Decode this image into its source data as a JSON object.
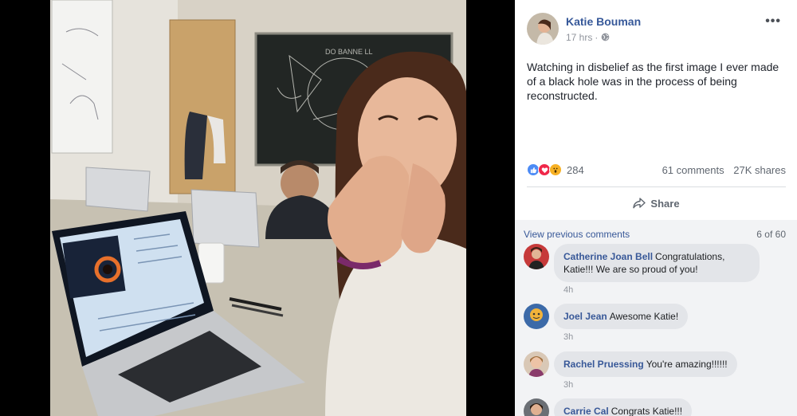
{
  "post": {
    "author": "Katie Bouman",
    "time": "17 hrs",
    "text": "Watching in disbelief as the first image I ever made of a black hole was in the process of being reconstructed.",
    "more_label": "•••"
  },
  "stats": {
    "reactions": "284",
    "comments": "61 comments",
    "shares": "27K shares",
    "reaction_types": [
      "like-icon",
      "love-icon",
      "wow-icon"
    ]
  },
  "actions": {
    "share_label": "Share"
  },
  "comments": {
    "view_previous": "View previous comments",
    "count": "6 of 60",
    "items": [
      {
        "name": "Catherine Joan Bell",
        "text": "Congratulations, Katie!!! We are so proud of you!",
        "time": "4h"
      },
      {
        "name": "Joel Jean",
        "text": "Awesome Katie!",
        "time": "3h"
      },
      {
        "name": "Rachel Pruessing",
        "text": "You're amazing!!!!!!",
        "time": "3h"
      },
      {
        "name": "Carrie Cal",
        "text": "Congrats Katie!!!",
        "time": ""
      }
    ]
  },
  "colors": {
    "link": "#365899",
    "meta": "#90949c",
    "bubble": "#e3e5e9",
    "comments_bg": "#f2f3f5"
  }
}
